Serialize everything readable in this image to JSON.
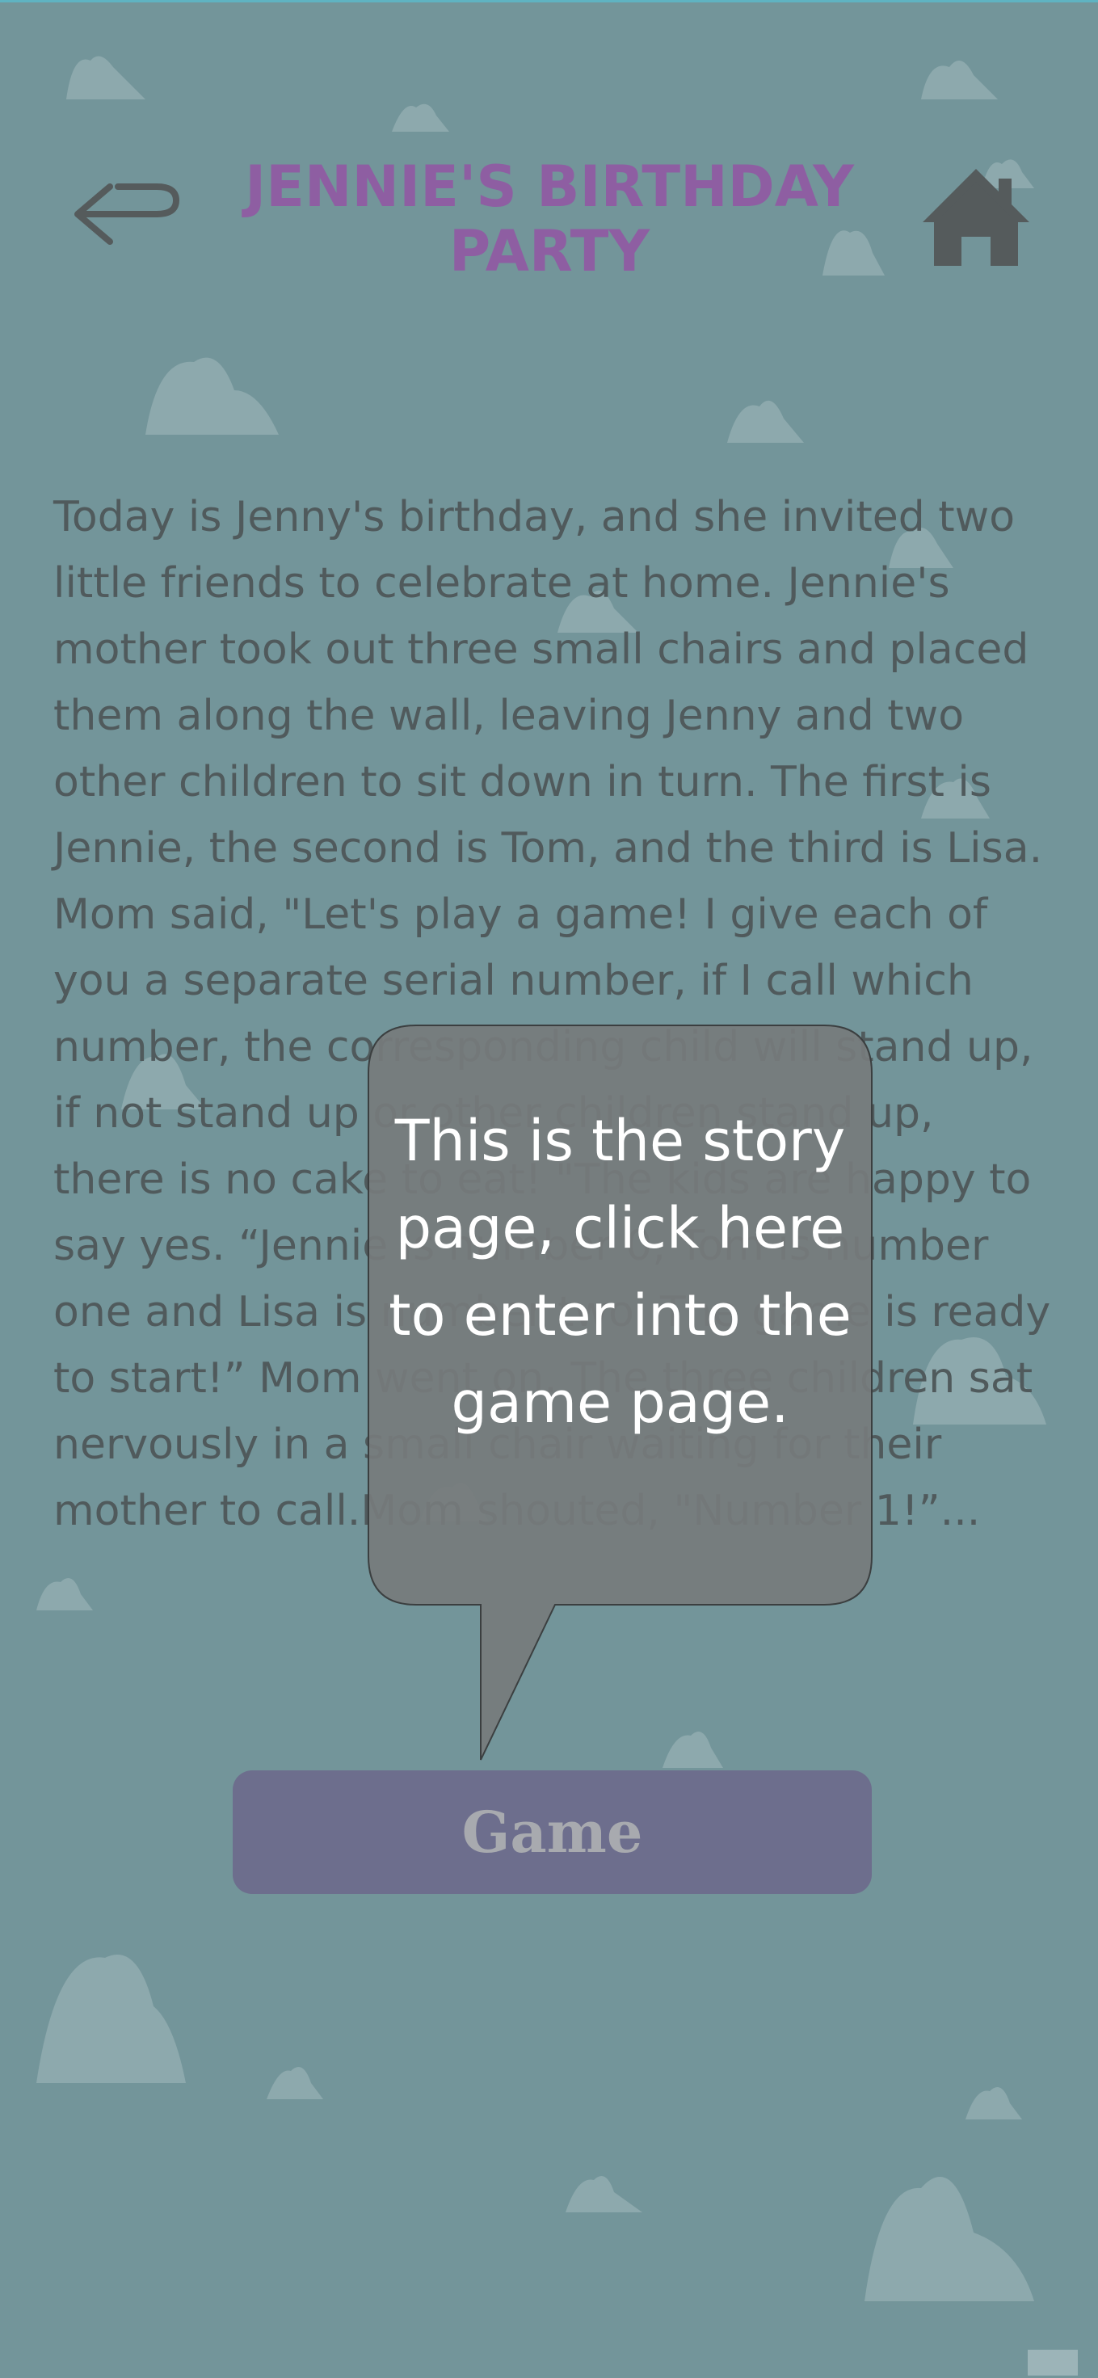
{
  "header": {
    "title": "JENNIE'S BIRTHDAY PARTY",
    "back_icon": "back-arrow-icon",
    "home_icon": "home-icon"
  },
  "story": {
    "text": "Today is Jenny's birthday, and she invited two little friends to celebrate at home. Jennie's mother took out three small chairs and placed them along the wall, leaving Jenny and two other children to sit down in turn. The first is Jennie, the second is Tom, and the third is Lisa. Mom said, \"Let's play a game! I give each of you a separate serial number, if I call which number, the corresponding child will stand up, if not stand up or other children stand up, there is no cake to eat! \"The kids are happy to say yes. “Jennie is number 0, Tom is number one and Lisa is number two. The game is ready to start!” Mom went on. The three children sat nervously in a small chair waiting for their mother to call.Mom shouted, \"Number 1!”..."
  },
  "game_button": {
    "label": "Game"
  },
  "tooltip": {
    "text": "This is the story page, click here to enter into the game page."
  },
  "colors": {
    "background": "#73959a",
    "title": "#8e5ea2",
    "story_text": "#505a5c",
    "game_button_bg": "#6d6e8d",
    "game_button_text": "#a8aaaf",
    "tooltip_bg": "#767b7c",
    "tooltip_text": "#ffffff",
    "icon": "#555b5c"
  }
}
